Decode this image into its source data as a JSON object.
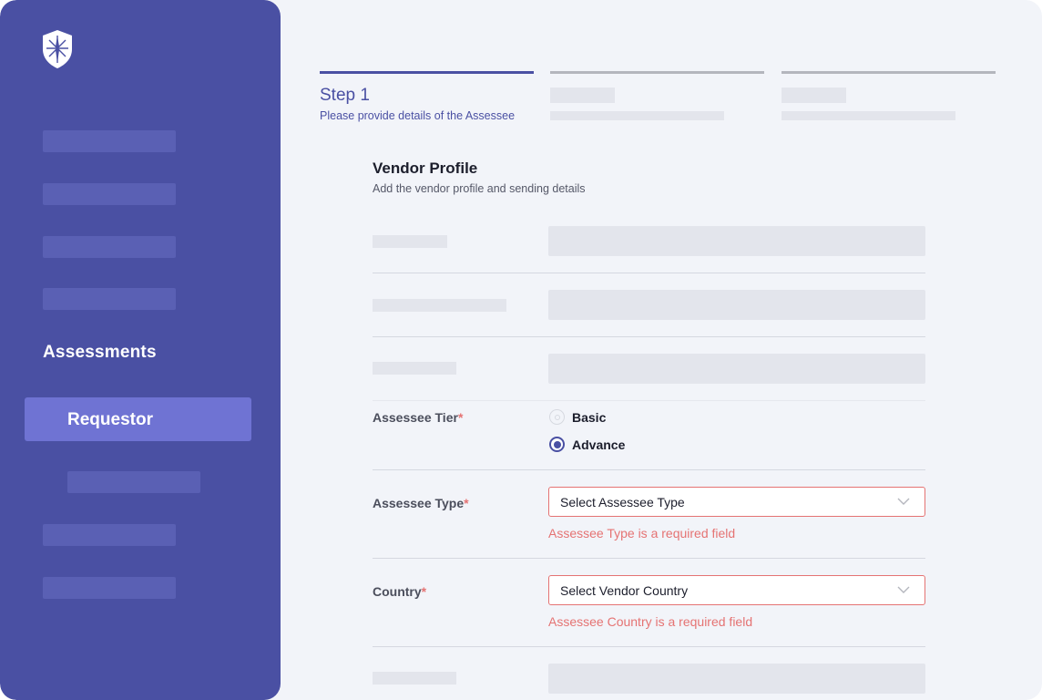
{
  "colors": {
    "sidebar_bg": "#4a50a3",
    "sidebar_active": "#6f73d3",
    "accent": "#4a50a3",
    "error": "#e57373",
    "page_bg": "#f2f4f9"
  },
  "sidebar": {
    "logo_icon": "shield-compass-icon",
    "section_label": "Assessments",
    "active_item_label": "Requestor"
  },
  "stepper": {
    "step1_title": "Step 1",
    "step1_subtitle": "Please provide details of the Assessee"
  },
  "form": {
    "title": "Vendor Profile",
    "subtitle": "Add the vendor profile and sending details",
    "tier": {
      "label": "Assessee Tier",
      "required_mark": "*",
      "options": [
        "Basic",
        "Advance"
      ],
      "selected": "Advance"
    },
    "type": {
      "label": "Assessee Type",
      "required_mark": "*",
      "placeholder": "Select Assessee Type",
      "error": "Assessee Type is a required field"
    },
    "country": {
      "label": "Country",
      "required_mark": "*",
      "placeholder": "Select Vendor Country",
      "error": "Assessee Country is a required field"
    }
  }
}
